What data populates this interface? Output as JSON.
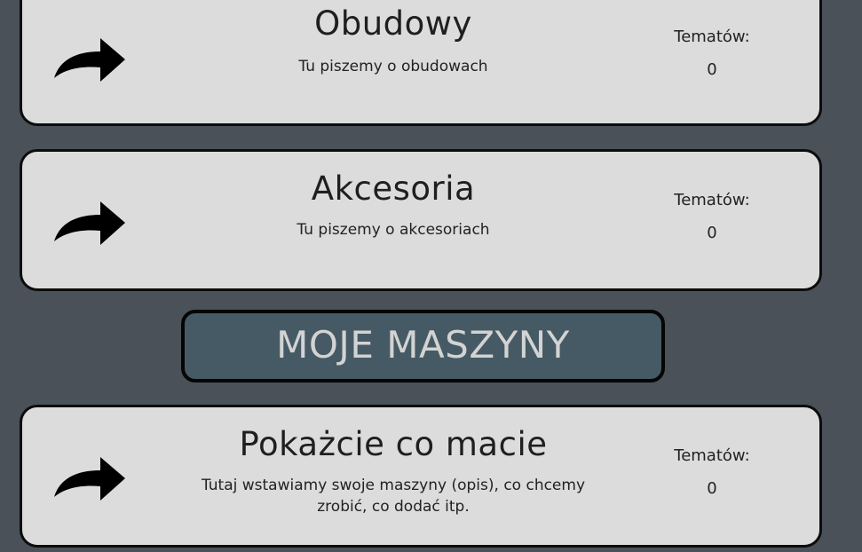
{
  "forums": [
    {
      "title": "Obudowy",
      "description": "Tu piszemy o obudowach",
      "topics_label": "Tematów:",
      "topics_count": "0",
      "icon": "share-arrow-icon"
    },
    {
      "title": "Akcesoria",
      "description": "Tu piszemy o akcesoriach",
      "topics_label": "Tematów:",
      "topics_count": "0",
      "icon": "share-arrow-icon"
    }
  ],
  "section": {
    "title": "MOJE MASZYNY"
  },
  "section_forums": [
    {
      "title": "Pokażcie co macie",
      "description": "Tutaj wstawiamy swoje maszyny (opis), co chcemy zrobić, co dodać itp.",
      "topics_label": "Tematów:",
      "topics_count": "0",
      "icon": "share-arrow-icon"
    }
  ],
  "colors": {
    "background": "#4b5159",
    "card": "#dcdcdc",
    "section_header": "#455a64",
    "section_text": "#d3d3d3"
  }
}
